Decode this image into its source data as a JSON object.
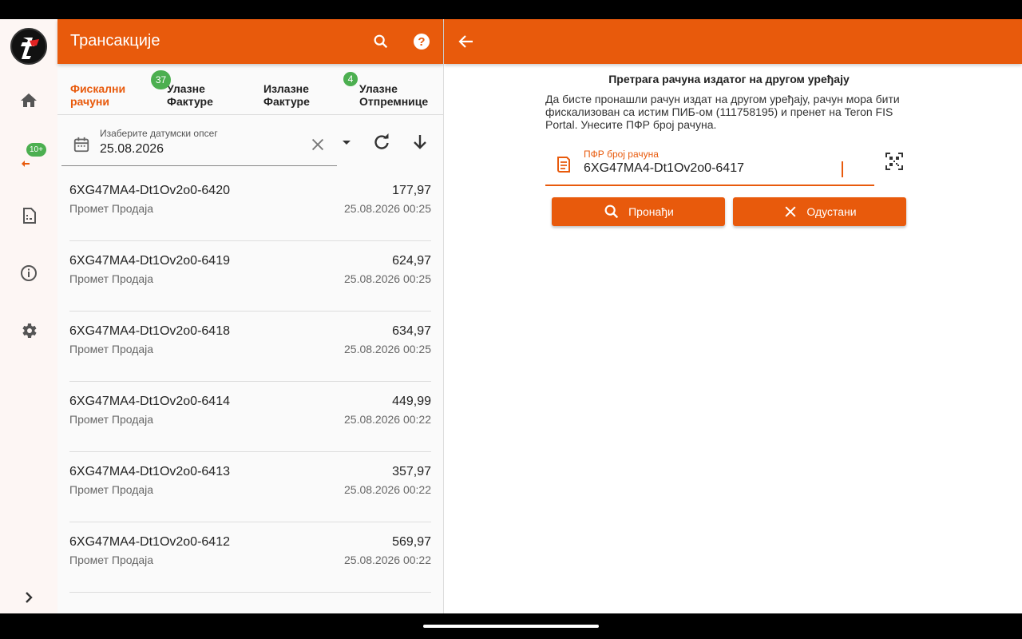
{
  "rail": {
    "badge": "10+"
  },
  "left": {
    "title": "Трансакције",
    "tabs": [
      {
        "label": "Фискални рачуни",
        "line1": "Фискални",
        "line2": "рачуни"
      },
      {
        "label": "Улазне Фактуре",
        "line1": "Улазне",
        "line2": "Фактуре",
        "badge": "37"
      },
      {
        "label": "Излазне Фактуре",
        "line1": "Излазне",
        "line2": "Фактуре"
      },
      {
        "label": "Улазне Отпремнице",
        "line1": "Улазне",
        "line2": "Отпремнице",
        "badge": "4"
      }
    ],
    "date_filter": {
      "label": "Изаберите датумски опсег",
      "value": "25.08.2026"
    },
    "transactions": [
      {
        "id": "6XG47MA4-Dt1Ov2o0-6420",
        "type": "Промет Продаја",
        "amount": "177,97",
        "date": "25.08.2026 00:25"
      },
      {
        "id": "6XG47MA4-Dt1Ov2o0-6419",
        "type": "Промет Продаја",
        "amount": "624,97",
        "date": "25.08.2026 00:25"
      },
      {
        "id": "6XG47MA4-Dt1Ov2o0-6418",
        "type": "Промет Продаја",
        "amount": "634,97",
        "date": "25.08.2026 00:25"
      },
      {
        "id": "6XG47MA4-Dt1Ov2o0-6414",
        "type": "Промет Продаја",
        "amount": "449,99",
        "date": "25.08.2026 00:22"
      },
      {
        "id": "6XG47MA4-Dt1Ov2o0-6413",
        "type": "Промет Продаја",
        "amount": "357,97",
        "date": "25.08.2026 00:22"
      },
      {
        "id": "6XG47MA4-Dt1Ov2o0-6412",
        "type": "Промет Продаја",
        "amount": "569,97",
        "date": "25.08.2026 00:22"
      }
    ]
  },
  "right": {
    "title": "Претрага рачуна издатог на другом уређају",
    "description": "Да бисте пронашли рачун издат на другом уређају, рачун мора бити фискализован са истим ПИБ-ом (111758195) и пренет на Teron FIS Portal. Унесите ПФР број рачуна.",
    "pfr_label": "ПФР број рачуна",
    "pfr_value": "6XG47MA4-Dt1Ov2o0-6417",
    "find_label": "Пронађи",
    "cancel_label": "Одустани"
  },
  "colors": {
    "accent": "#e85a0c",
    "badge": "#4caf50"
  }
}
